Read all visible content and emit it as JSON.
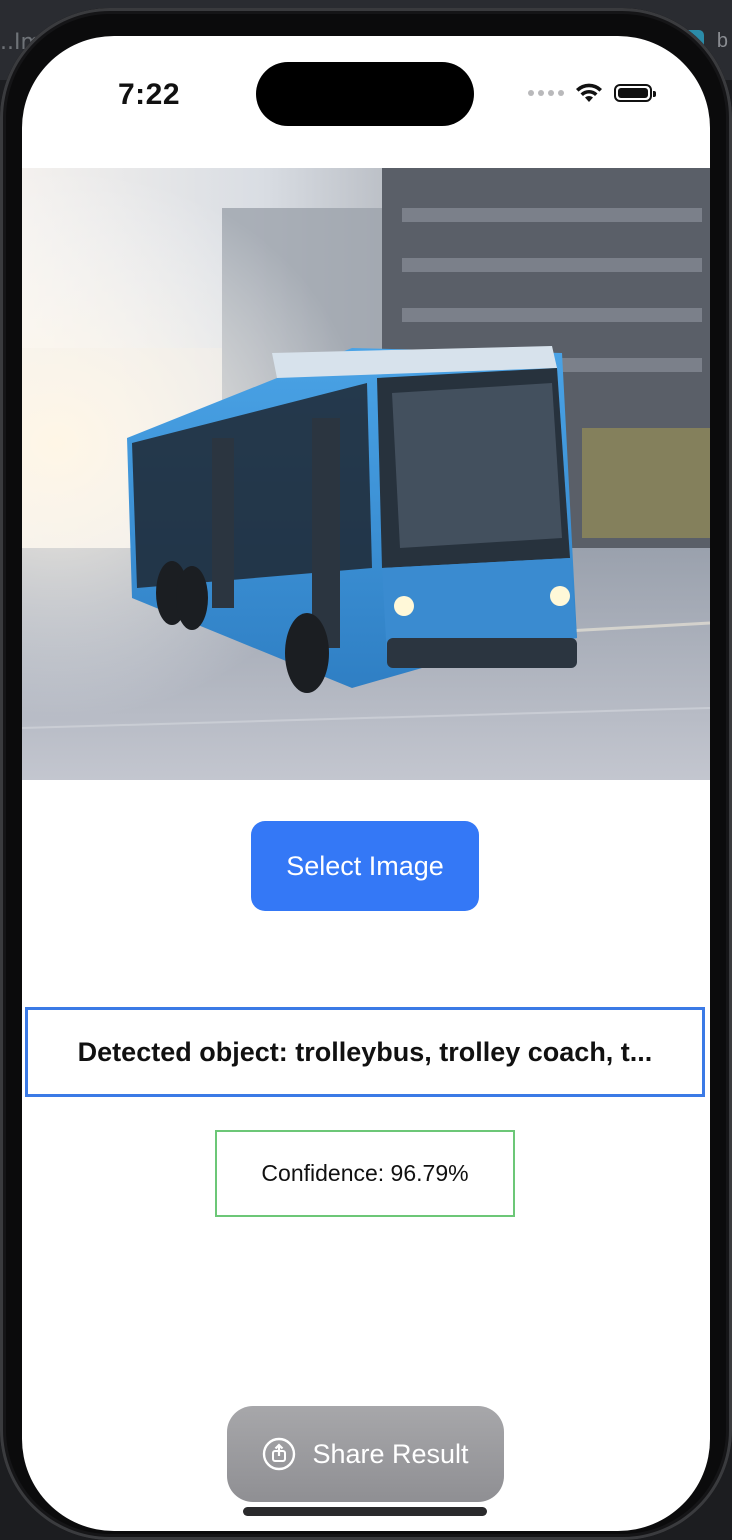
{
  "status_bar": {
    "time": "7:22"
  },
  "background": {
    "left_text": "..Im",
    "right_text": "b"
  },
  "photo": {
    "subject": "bus-photo"
  },
  "select_button": {
    "label": "Select Image"
  },
  "result": {
    "detected_label": "Detected object: trolleybus, trolley coach, t...",
    "confidence_label": "Confidence: 96.79%"
  },
  "share_button": {
    "label": "Share Result",
    "icon": "share-icon"
  },
  "colors": {
    "accent": "#3478f6",
    "detected_border": "#3b7ae6",
    "confidence_border": "#6cc777",
    "share_bg": "#9a9a9e"
  }
}
